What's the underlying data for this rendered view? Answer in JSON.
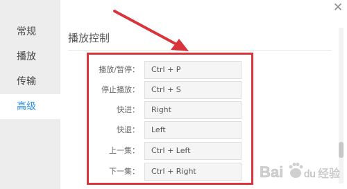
{
  "sidebar": {
    "items": [
      {
        "label": "常规"
      },
      {
        "label": "播放"
      },
      {
        "label": "传输"
      },
      {
        "label": "高级"
      }
    ]
  },
  "main": {
    "section_title": "播放控制",
    "shortcuts": [
      {
        "label": "播放/暂停：",
        "value": "Ctrl + P"
      },
      {
        "label": "停止播放：",
        "value": "Ctrl + S"
      },
      {
        "label": "快进：",
        "value": "Right"
      },
      {
        "label": "快退：",
        "value": "Left"
      },
      {
        "label": "上一集：",
        "value": "Ctrl + Left"
      },
      {
        "label": "下一集：",
        "value": "Ctrl + Right"
      }
    ]
  },
  "window": {
    "close_icon": "close-icon"
  },
  "colors": {
    "accent": "#2a8ee6",
    "annotation": "#d9343b"
  },
  "watermark": {
    "brand": "Bai",
    "brand_suffix": "du",
    "site": "经验"
  }
}
